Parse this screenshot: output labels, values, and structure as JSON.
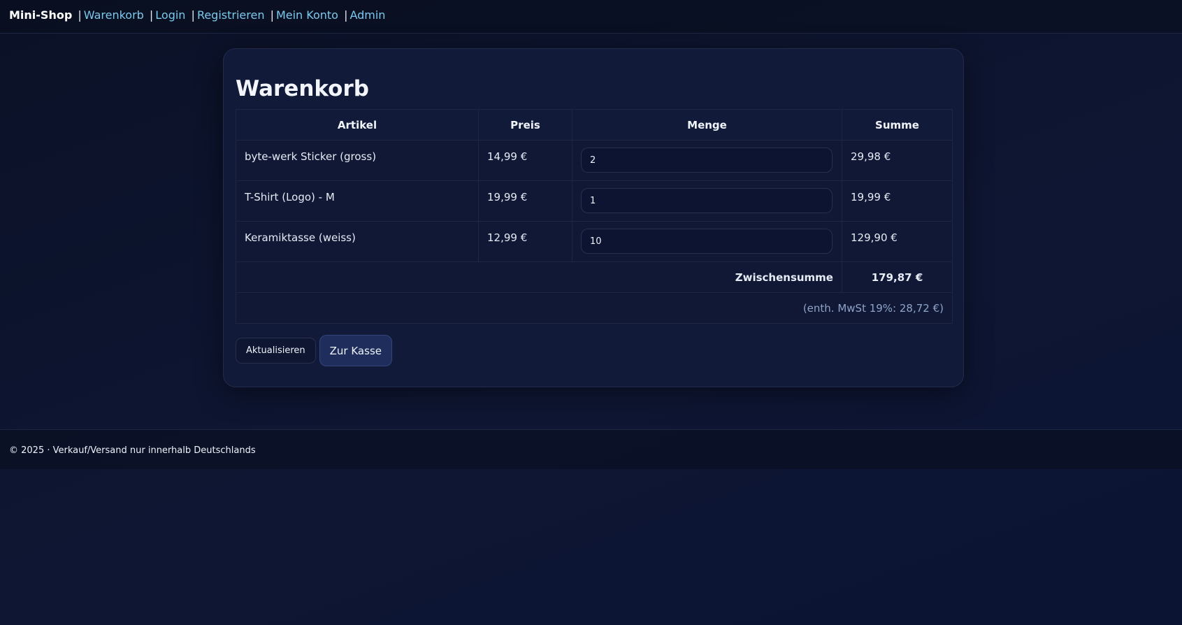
{
  "nav": {
    "brand": "Mini-Shop",
    "separator": "|",
    "links": [
      "Warenkorb",
      "Login",
      "Registrieren",
      "Mein Konto",
      "Admin"
    ]
  },
  "cart": {
    "title": "Warenkorb",
    "columns": [
      "Artikel",
      "Preis",
      "Menge",
      "Summe"
    ],
    "items": [
      {
        "name": "byte-werk Sticker (gross)",
        "price": "14,99 €",
        "qty": "2",
        "sum": "29,98 €"
      },
      {
        "name": "T-Shirt (Logo) - M",
        "price": "19,99 €",
        "qty": "1",
        "sum": "19,99 €"
      },
      {
        "name": "Keramiktasse (weiss)",
        "price": "12,99 €",
        "qty": "10",
        "sum": "129,90 €"
      }
    ],
    "subtotal_label": "Zwischensumme",
    "subtotal_value": "179,87 €",
    "vat_note": "(enth. MwSt 19%: 28,72 €)",
    "update_label": "Aktualisieren",
    "checkout_label": "Zur Kasse"
  },
  "footer": {
    "text": "© 2025 · Verkauf/Versand nur innerhalb Deutschlands"
  },
  "colors": {
    "background": "#0e1633",
    "card": "#111a38",
    "link": "#7cc9ee",
    "muted": "#8ea3c8",
    "primary_button": "#1f2d5c"
  }
}
